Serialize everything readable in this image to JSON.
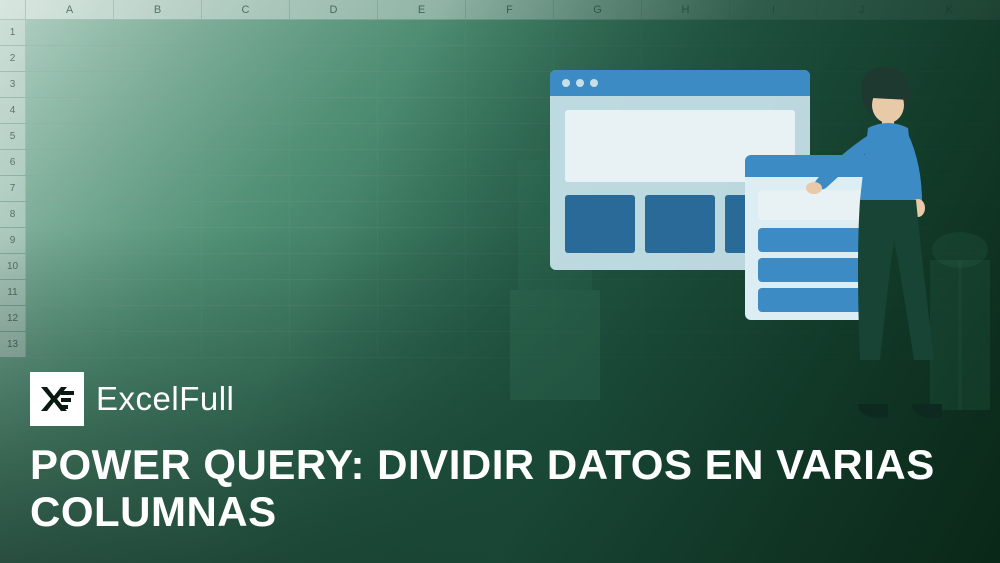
{
  "spreadsheet": {
    "columns": [
      "A",
      "B",
      "C",
      "D",
      "E",
      "F",
      "G",
      "H",
      "I",
      "J",
      "K"
    ],
    "rows": [
      "1",
      "2",
      "3",
      "4",
      "5",
      "6",
      "7",
      "8",
      "9",
      "10",
      "11",
      "12",
      "13"
    ]
  },
  "brand": {
    "name_strong": "Excel",
    "name_light": "Full"
  },
  "title": "POWER QUERY: DIVIDIR DATOS EN VARIAS COLUMNAS",
  "colors": {
    "accent_blue": "#3d8bc4",
    "dark_blue": "#2a6a98",
    "dark_green": "#1a4a38",
    "teal": "#4a9e80"
  }
}
